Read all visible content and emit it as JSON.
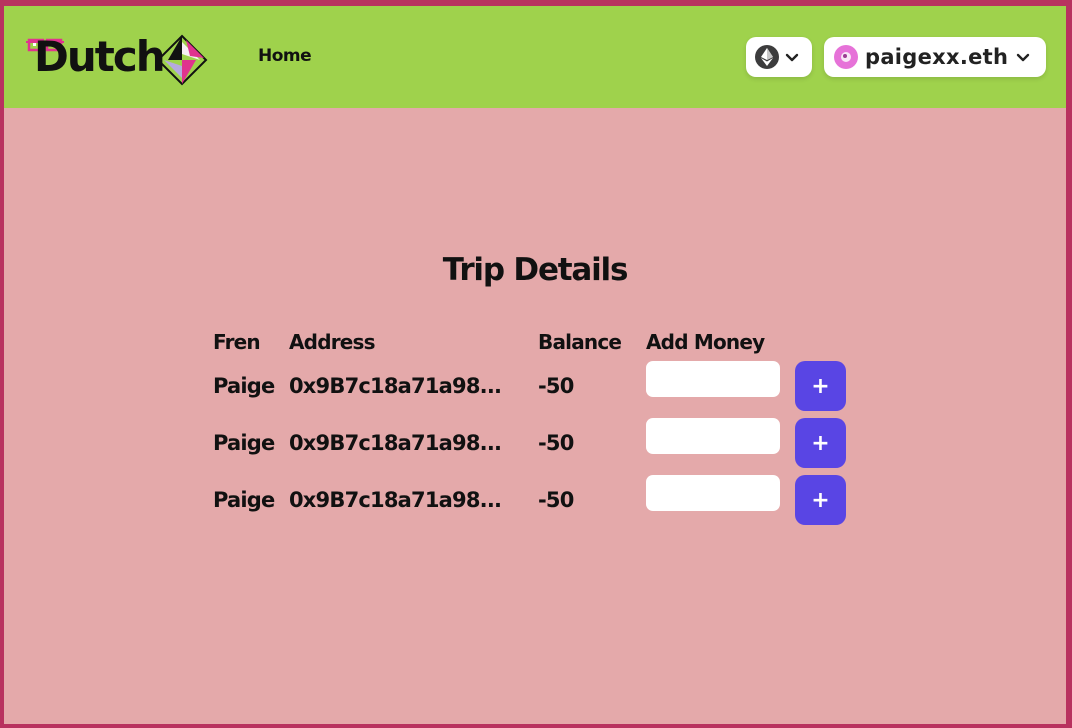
{
  "brand": {
    "name": "Dutch"
  },
  "nav": {
    "home_label": "Home"
  },
  "wallet": {
    "chain_icon": "ethereum-icon",
    "account_name": "paigexx.eth",
    "avatar_color": "#e672d8"
  },
  "trip": {
    "title": "Trip Details",
    "columns": {
      "fren": "Fren",
      "address": "Address",
      "balance": "Balance",
      "add_money": "Add Money"
    },
    "rows": [
      {
        "fren": "Paige",
        "address": "0x9B7c18a71a98...",
        "balance": "-50",
        "amount_value": "",
        "add_label": "+"
      },
      {
        "fren": "Paige",
        "address": "0x9B7c18a71a98...",
        "balance": "-50",
        "amount_value": "",
        "add_label": "+"
      },
      {
        "fren": "Paige",
        "address": "0x9B7c18a71a98...",
        "balance": "-50",
        "amount_value": "",
        "add_label": "+"
      }
    ]
  },
  "colors": {
    "border": "#b8325f",
    "navbar": "#9fd24c",
    "background": "#e4a9aa",
    "button": "#5945e4"
  }
}
